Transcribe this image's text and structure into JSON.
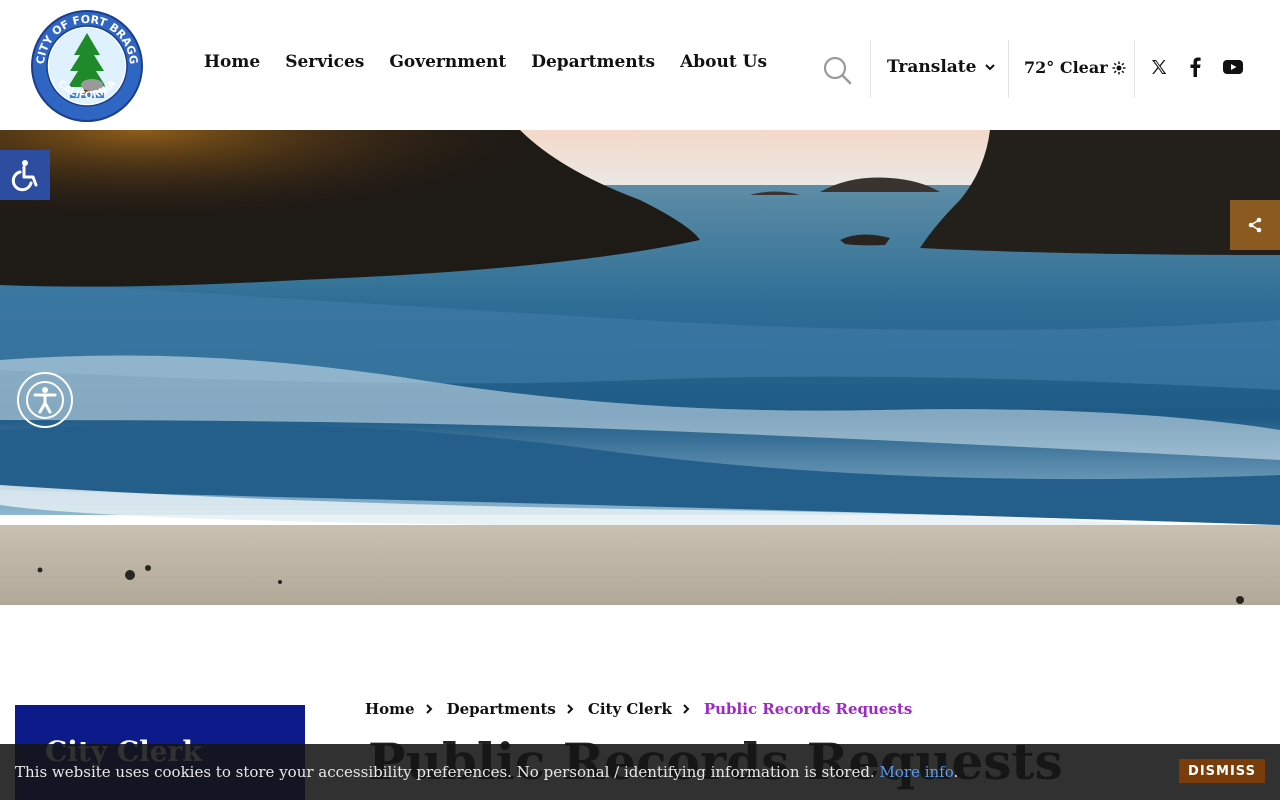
{
  "header": {
    "logo": {
      "text_top": "CITY OF FORT BRAGG",
      "text_bottom": "CALIFORNIA",
      "icon": "city-seal-logo"
    },
    "nav": [
      {
        "label": "Home"
      },
      {
        "label": "Services"
      },
      {
        "label": "Government"
      },
      {
        "label": "Departments"
      },
      {
        "label": "About Us"
      }
    ],
    "search_icon": "search-icon",
    "translate": {
      "label": "Translate",
      "icon": "chevron-down-icon"
    },
    "weather": {
      "text": "72° Clear",
      "icon": "sun-icon"
    },
    "social": [
      {
        "name": "x-twitter-icon"
      },
      {
        "name": "facebook-icon"
      },
      {
        "name": "youtube-icon"
      }
    ]
  },
  "floating": {
    "accessibility_left": "accessibility-wheelchair-icon",
    "share": "share-icon",
    "accessibility_circle": "accessibility-person-icon"
  },
  "sidebar": {
    "title": "City Clerk"
  },
  "breadcrumb": {
    "items": [
      "Home",
      "Departments",
      "City Clerk"
    ],
    "current": "Public Records Requests"
  },
  "page": {
    "title": "Public Records Requests"
  },
  "cookie": {
    "message": "This website uses cookies to store your accessibility preferences. No personal / identifying information is stored.",
    "link": "More info",
    "suffix": ".",
    "dismiss": "DISMISS"
  },
  "colors": {
    "accent_blue": "#0d1a8a",
    "breadcrumb_current": "#9b2bc2",
    "dismiss_bg": "#7a3d0a",
    "share_bg": "#8a5a20",
    "access_bg": "#2d4ea0"
  }
}
